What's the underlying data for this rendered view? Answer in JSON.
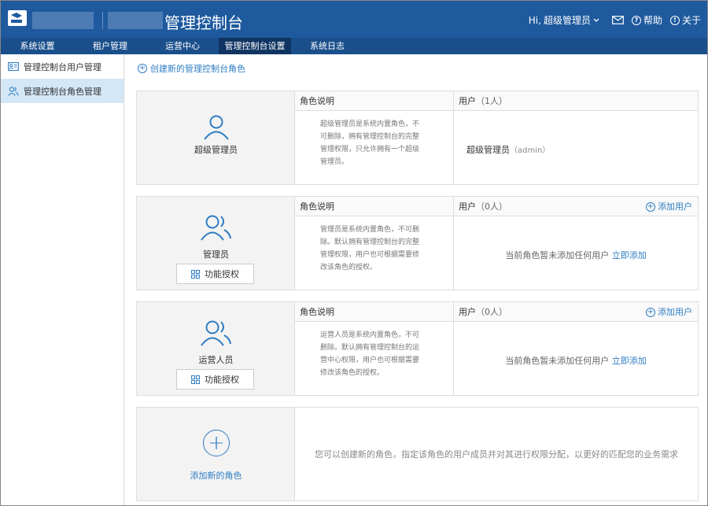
{
  "header": {
    "app_title": "管理控制台",
    "greeting": "Hi,",
    "username": "超级管理员",
    "help_label": "帮助",
    "about_label": "关于",
    "icons": [
      "logo-icon",
      "chevron-down-icon",
      "mail-icon",
      "help-icon",
      "info-icon"
    ]
  },
  "nav": {
    "tabs": [
      {
        "label": "系统设置",
        "active": false
      },
      {
        "label": "租户管理",
        "active": false
      },
      {
        "label": "运营中心",
        "active": false
      },
      {
        "label": "管理控制台设置",
        "active": true
      },
      {
        "label": "系统日志",
        "active": false
      }
    ]
  },
  "sidebar": {
    "items": [
      {
        "label": "管理控制台用户管理",
        "icon": "id-card-icon",
        "active": false
      },
      {
        "label": "管理控制台角色管理",
        "icon": "users-icon",
        "active": true
      }
    ]
  },
  "main": {
    "create_link": "创建新的管理控制台角色",
    "desc_header": "角色说明",
    "user_header": "用户",
    "add_user_label": "添加用户",
    "empty_text": "当前角色暂未添加任何用户",
    "empty_link": "立即添加",
    "auth_label": "功能授权",
    "roles": [
      {
        "name": "超级管理员",
        "count": "（1人）",
        "desc": "超级管理员是系统内置角色，不可删除，拥有管理控制台的完整管理权限，只允许拥有一个超级管理员。",
        "user": "超级管理员",
        "user_id": "（admin）"
      },
      {
        "name": "管理员",
        "count": "（0人）",
        "desc": "管理员是系统内置角色，不可删除。默认拥有管理控制台的完整管理权限，用户也可根据需要修改该角色的授权。"
      },
      {
        "name": "运营人员",
        "count": "（0人）",
        "desc": "运营人员是系统内置角色，不可删除。默认拥有管理控制台的运营中心权限，用户也可根据需要修改该角色的授权。"
      }
    ],
    "add_role_label": "添加新的角色",
    "add_role_desc": "您可以创建新的角色，指定该角色的用户成员并对其进行权限分配，以更好的匹配您的业务需求"
  },
  "colors": {
    "header_bg": "#1f5a9e",
    "nav_bg": "#1a4f8b",
    "nav_active_bg": "#0f3463",
    "accent": "#2f7dc4",
    "sidebar_active": "#d4e7f7"
  }
}
